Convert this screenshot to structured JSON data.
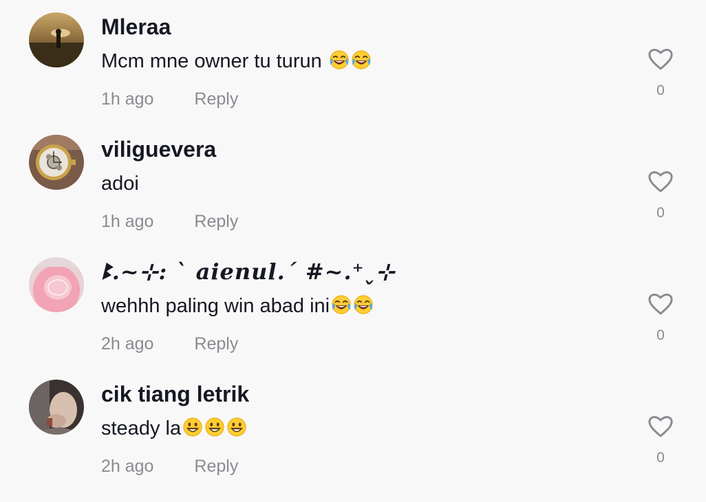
{
  "comments": [
    {
      "username": "Mleraa",
      "text": "Mcm mne owner tu turun ",
      "emojis": [
        "face-with-tears-of-joy",
        "face-with-tears-of-joy"
      ],
      "time": "1h ago",
      "reply_label": "Reply",
      "like_count": "0",
      "avatar": "silhouette-sunset-avatar"
    },
    {
      "username": "viliguevera",
      "text": "adoi",
      "emojis": [],
      "time": "1h ago",
      "reply_label": "Reply",
      "like_count": "0",
      "avatar": "wristwatch-avatar"
    },
    {
      "username": "ꔪ.~⊹: ˋ 𝒂𝒊𝒆𝒏𝒖𝒍.ˊ #~.⁺˯⊹",
      "text": "wehhh paling win abad ini",
      "emojis": [
        "face-with-tears-of-joy",
        "face-with-tears-of-joy"
      ],
      "time": "2h ago",
      "reply_label": "Reply",
      "like_count": "0",
      "avatar": "pink-hijab-avatar"
    },
    {
      "username": "cik tiang letrik",
      "text": "steady la",
      "emojis": [
        "grinning-face",
        "grinning-face",
        "grinning-face"
      ],
      "time": "2h ago",
      "reply_label": "Reply",
      "like_count": "0",
      "avatar": "portrait-avatar"
    }
  ],
  "icons": {
    "like": "heart-outline-icon"
  },
  "colors": {
    "background": "#f8f8f8",
    "username": "#161823",
    "secondary_text": "#8a8b91",
    "heart_outline": "#8a8b91"
  }
}
